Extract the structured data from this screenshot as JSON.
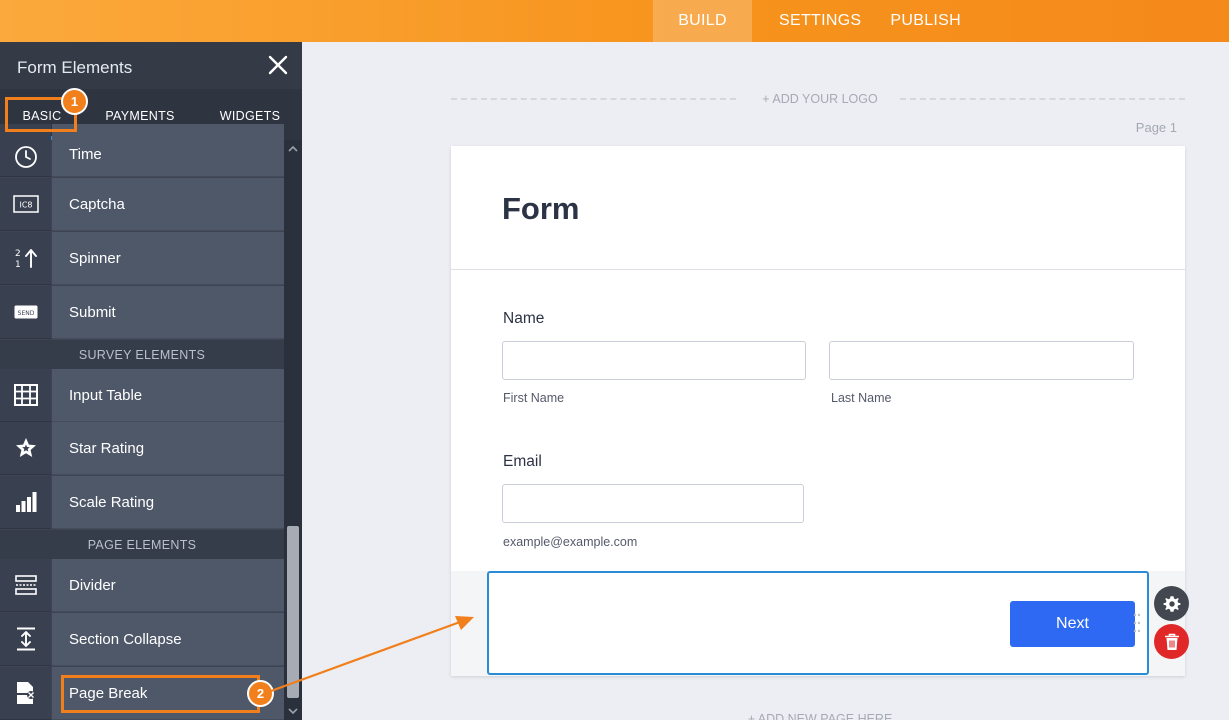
{
  "topbar": {
    "nav": [
      {
        "label": "BUILD",
        "active": true
      },
      {
        "label": "SETTINGS",
        "active": false
      },
      {
        "label": "PUBLISH",
        "active": false
      }
    ],
    "accent": "#f7941d"
  },
  "sidebar": {
    "title": "Form Elements",
    "close_icon": "close-icon",
    "tabs": [
      {
        "label": "BASIC",
        "active": true
      },
      {
        "label": "PAYMENTS",
        "active": false
      },
      {
        "label": "WIDGETS",
        "active": false
      }
    ],
    "items": [
      {
        "label": "Time",
        "icon": "clock-icon"
      },
      {
        "label": "Captcha",
        "icon": "captcha-icon"
      },
      {
        "label": "Spinner",
        "icon": "spinner-icon"
      },
      {
        "label": "Submit",
        "icon": "send-icon"
      },
      {
        "label": "Input Table",
        "icon": "table-icon"
      },
      {
        "label": "Star Rating",
        "icon": "star-icon"
      },
      {
        "label": "Scale Rating",
        "icon": "bar-chart-icon"
      },
      {
        "label": "Divider",
        "icon": "divider-icon"
      },
      {
        "label": "Section Collapse",
        "icon": "collapse-icon"
      },
      {
        "label": "Page Break",
        "icon": "page-break-icon"
      }
    ],
    "sections": {
      "survey": "SURVEY ELEMENTS",
      "page": "PAGE ELEMENTS"
    },
    "captcha_icon_text": "IC8",
    "send_icon_text": "SEND"
  },
  "canvas": {
    "add_logo": "+ ADD YOUR LOGO",
    "page_label": "Page 1",
    "form_title": "Form",
    "name_label": "Name",
    "first_name": "First Name",
    "last_name": "Last Name",
    "email_label": "Email",
    "email_hint": "example@example.com",
    "next_button": "Next",
    "add_page": "+ ADD NEW PAGE HERE"
  },
  "annotations": {
    "badge1": "1",
    "badge2": "2",
    "color": "#f07f1c"
  }
}
